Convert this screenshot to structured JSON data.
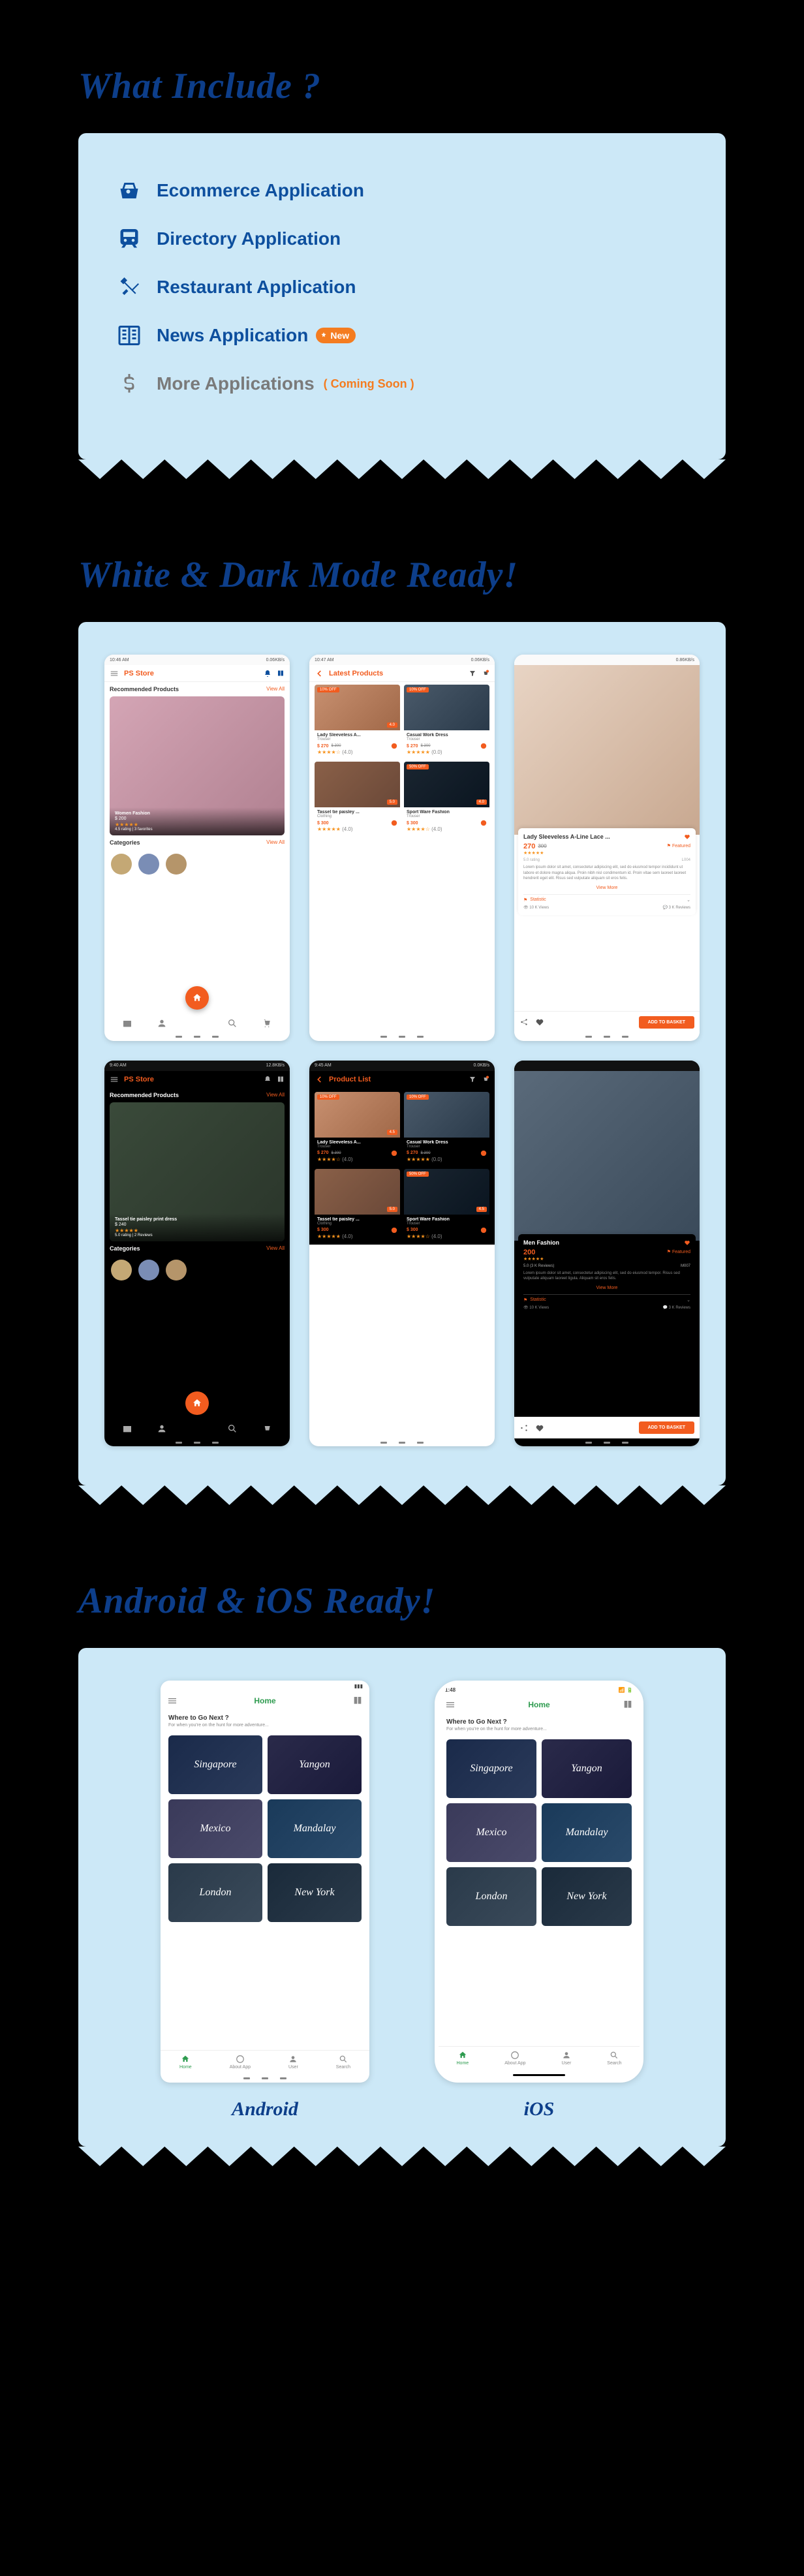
{
  "section1": {
    "title": "What Include ?",
    "items": [
      {
        "label": "Ecommerce Application",
        "icon": "basket",
        "muted": false,
        "badge": null
      },
      {
        "label": "Directory Application",
        "icon": "train",
        "muted": false,
        "badge": null
      },
      {
        "label": "Restaurant Application",
        "icon": "utensils",
        "muted": false,
        "badge": null
      },
      {
        "label": "News Application",
        "icon": "news",
        "muted": false,
        "badge": "New"
      },
      {
        "label": "More Applications",
        "icon": "dollar",
        "muted": true,
        "badge_soon": "( Coming Soon )"
      }
    ]
  },
  "section2": {
    "title": "White & Dark Mode Ready!",
    "phones": {
      "light_home": {
        "time": "10:46 AM",
        "net": "0.06KB/s",
        "app_title": "PS Store",
        "rec_label": "Recommended Products",
        "view_all": "View All",
        "hero_title": "Women Fashion",
        "hero_price": "$ 200",
        "hero_meta": "4.5 rating | 3 favorites",
        "cat_label": "Categories"
      },
      "light_list": {
        "time": "10:47 AM",
        "net": "0.06KB/s",
        "app_title": "Latest Products",
        "products": [
          {
            "badge": "10% OFF",
            "rate": "4.0",
            "name": "Lady Sleeveless A...",
            "sub": "Trouser",
            "price": "$ 270",
            "old": "$ 300"
          },
          {
            "badge": "10% OFF",
            "rate": "",
            "name": "Casual Work Dress",
            "sub": "Trouser",
            "price": "$ 270",
            "old": "$ 300"
          },
          {
            "badge": "",
            "rate": "5.0",
            "name": "Tassel tie paisley ...",
            "sub": "Clothing",
            "price": "$ 300",
            "old": ""
          },
          {
            "badge": "50% OFF",
            "rate": "4.0",
            "name": "Sport Ware Fashion",
            "sub": "Trouser",
            "price": "$ 300",
            "old": ""
          }
        ]
      },
      "light_detail": {
        "net": "0.86KB/s",
        "title": "Lady Sleeveless A-Line Lace ...",
        "price": "270",
        "old": "300",
        "featured": "Featured",
        "rating_text": "5.0 rating",
        "code": "L004",
        "desc": "Lorem ipsum dolor sit amet, consectetur adipiscing elit, sed do eiusmod tempor incididunt ut labore et dolore magna aliqua. Proin nibh nisl condimentum id. Proin vitae sem laoreet laoreet hendrerit eget elit. Risus sed vulputate aliquam sit eros felis.",
        "view_more": "View More",
        "statistic": "Statistic",
        "views": "10 K Views",
        "reviews": "3 K Reviews",
        "add": "ADD TO BASKET"
      },
      "dark_home": {
        "time": "9:40 AM",
        "net": "12.8KB/s",
        "app_title": "PS Store",
        "rec_label": "Recommended Products",
        "view_all": "View All",
        "hero_title": "Tassel tie paisley print dress",
        "hero_price": "$ 240",
        "hero_meta": "5.0 rating | 2 Reviews",
        "cat_label": "Categories"
      },
      "dark_list": {
        "time": "9:45 AM",
        "net": "0.0KB/s",
        "app_title": "Product List",
        "products": [
          {
            "badge": "10% OFF",
            "rate": "4.5",
            "name": "Lady Sleeveless A...",
            "sub": "Trouser",
            "price": "$ 270",
            "old": "$ 300"
          },
          {
            "badge": "10% OFF",
            "rate": "",
            "name": "Casual Work Dress",
            "sub": "Trouser",
            "price": "$ 270",
            "old": "$ 300"
          },
          {
            "badge": "",
            "rate": "5.0",
            "name": "Tassel tie paisley ...",
            "sub": "Clothing",
            "price": "$ 300",
            "old": ""
          },
          {
            "badge": "50% OFF",
            "rate": "4.5",
            "name": "Sport Ware Fashion",
            "sub": "Trouser",
            "price": "$ 300",
            "old": ""
          }
        ]
      },
      "dark_detail": {
        "title": "Men Fashion",
        "price": "200",
        "featured": "Featured",
        "rating_text": "5.0 (3 K Reviews)",
        "code": "M007",
        "desc": "Lorem ipsum dolor sit amet, consectetur adipiscing elit, sed do eiusmod tempor. Risus sed vulputate aliquam laoreet ligula. Aliquam sit eros felis.",
        "view_more": "View More",
        "statistic": "Statistic",
        "views": "10 K Views",
        "reviews": "3 K Reviews",
        "add": "ADD TO BASKET"
      }
    }
  },
  "section3": {
    "title": "Android & iOS Ready!",
    "home_title": "Home",
    "question": "Where to Go Next ?",
    "subtitle": "For when you're on the hunt for more adventure...",
    "cities": [
      "Singapore",
      "Yangon",
      "Mexico",
      "Mandalay",
      "London",
      "New York"
    ],
    "nav": [
      "Home",
      "About App",
      "User",
      "Search"
    ],
    "android_label": "Android",
    "ios_label": "iOS",
    "ios_time": "1:48"
  }
}
